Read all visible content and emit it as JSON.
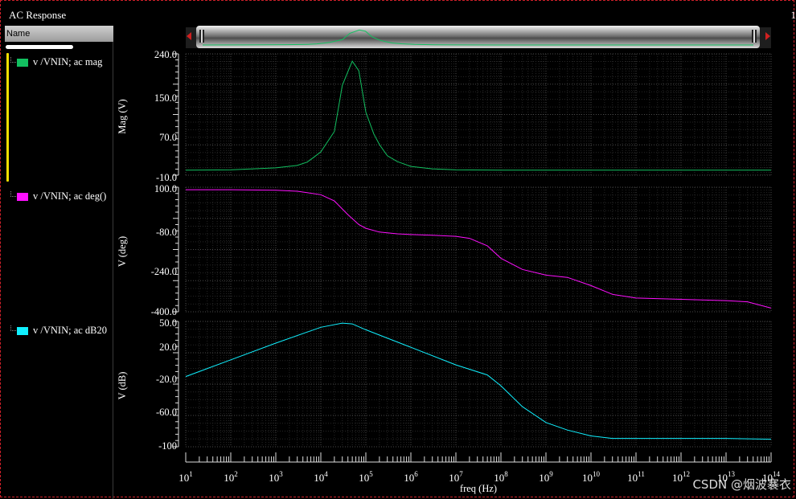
{
  "window": {
    "title": "AC Response",
    "corner_text": "1"
  },
  "legend": {
    "header": "Name",
    "traces": [
      {
        "label": "v /VNIN; ac mag",
        "color": "#12c060"
      },
      {
        "label": "v /VNIN; ac deg()",
        "color": "#ff10ff"
      },
      {
        "label": "v /VNIN; ac dB20",
        "color": "#10f0ff"
      }
    ]
  },
  "watermark": "CSDN @烟波褰衣",
  "chart_data": [
    {
      "type": "line",
      "title": "",
      "ylabel": "Mag (V)",
      "xscale": "log",
      "xlim": [
        10,
        100000000000000.0
      ],
      "ylim": [
        -10,
        240
      ],
      "yticks": [
        "240.0",
        "150.0",
        "70.0",
        "-10.0"
      ],
      "grid": true,
      "series": [
        {
          "name": "v /VNIN; ac mag",
          "color": "#12c060",
          "x": [
            10,
            100,
            1000,
            3000,
            5000,
            7000,
            10000,
            20000,
            30000,
            50000,
            70000,
            100000,
            150000,
            200000,
            300000,
            500000,
            1000000,
            3000000,
            10000000.0,
            100000000.0,
            10000000000.0,
            100000000000000.0
          ],
          "y": [
            0.5,
            1,
            5,
            10,
            17,
            27,
            38,
            80,
            175,
            225,
            205,
            120,
            75,
            53,
            30,
            18,
            8,
            3,
            1,
            0.5,
            0.5,
            0.5
          ]
        }
      ]
    },
    {
      "type": "line",
      "title": "",
      "ylabel": "V (deg)",
      "xscale": "log",
      "xlim": [
        10,
        100000000000000.0
      ],
      "ylim": [
        -400,
        100
      ],
      "yticks": [
        "100.0",
        "-80.0",
        "-240.0",
        "-400.0"
      ],
      "grid": true,
      "series": [
        {
          "name": "v /VNIN; ac deg()",
          "color": "#ff10ff",
          "x": [
            10,
            100,
            1000,
            3000,
            10000,
            20000,
            40000,
            70000,
            100000,
            200000,
            500000,
            1000000,
            3000000,
            10000000.0,
            20000000.0,
            50000000.0,
            100000000.0,
            300000000.0,
            1000000000.0,
            3000000000.0,
            10000000000.0,
            30000000000.0,
            100000000000.0,
            1000000000000.0,
            10000000000000.0,
            30000000000000.0,
            100000000000000.0
          ],
          "y": [
            90,
            90,
            88,
            84,
            70,
            45,
            -10,
            -50,
            -65,
            -80,
            -87,
            -90,
            -93,
            -97,
            -105,
            -135,
            -185,
            -230,
            -253,
            -262,
            -295,
            -330,
            -345,
            -350,
            -355,
            -360,
            -385
          ]
        }
      ]
    },
    {
      "type": "line",
      "title": "",
      "ylabel": "V (dB)",
      "xscale": "log",
      "xlim": [
        10,
        100000000000000.0
      ],
      "ylim": [
        -100,
        50
      ],
      "yticks": [
        "50.0",
        "20.0",
        "-20.0",
        "-60.0",
        "-100"
      ],
      "grid": true,
      "series": [
        {
          "name": "v /VNIN; ac dB20",
          "color": "#10f0ff",
          "x": [
            10,
            100,
            1000,
            10000,
            30000,
            50000,
            100000,
            1000000,
            10000000.0,
            50000000.0,
            100000000.0,
            300000000.0,
            1000000000.0,
            3000000000.0,
            10000000000.0,
            30000000000.0,
            100000000000.0,
            1000000000000.0,
            10000000000000.0,
            100000000000000.0
          ],
          "y": [
            -16,
            4,
            24,
            43,
            48,
            47,
            40,
            19,
            -2,
            -14,
            -27,
            -52,
            -71,
            -80,
            -87,
            -90,
            -90,
            -90,
            -90,
            -91
          ]
        }
      ]
    }
  ],
  "xaxis": {
    "label": "freq (Hz)",
    "base": "10",
    "exponents": [
      "1",
      "2",
      "3",
      "4",
      "5",
      "6",
      "7",
      "8",
      "9",
      "10",
      "11",
      "12",
      "13",
      "14"
    ]
  }
}
